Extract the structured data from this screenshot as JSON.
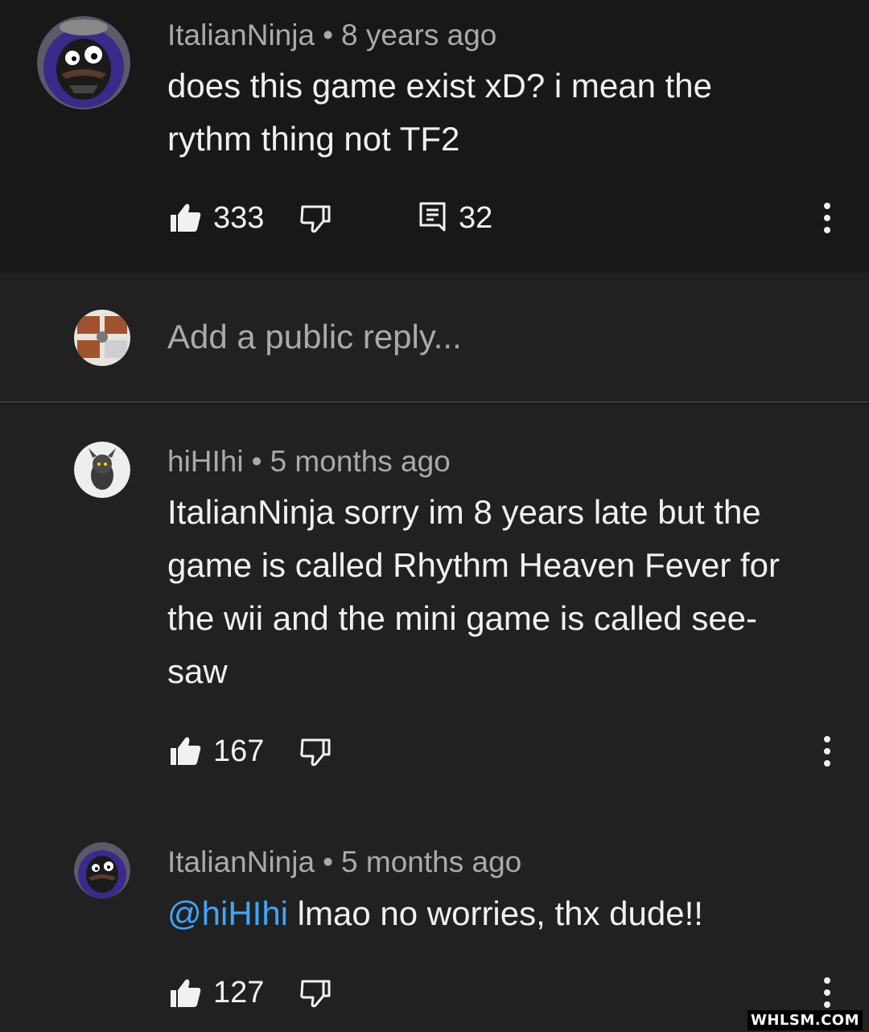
{
  "comment": {
    "author": "ItalianNinja",
    "time": "8 years ago",
    "text_line1": "does this game exist xD? i mean the",
    "text_line2": "rythm thing not TF2",
    "likes": "333",
    "reply_count": "32"
  },
  "reply_input": {
    "placeholder": "Add a public reply..."
  },
  "replies": [
    {
      "author": "hiHIhi",
      "time": "5 months ago",
      "lines": [
        "ItalianNinja sorry im 8 years late but the",
        "game is called Rhythm Heaven Fever for",
        "the wii and the mini game is called see-",
        "saw"
      ],
      "likes": "167"
    },
    {
      "author": "ItalianNinja",
      "time": "5 months ago",
      "mention": "@hiHIhi",
      "text": " lmao no worries, thx dude!!",
      "likes": "127"
    }
  ],
  "separator": "•",
  "watermark": "WHLSM.COM",
  "colors": {
    "background_top": "#181818",
    "background_replies": "#212121",
    "text_primary": "#f1f1f1",
    "text_secondary": "#aaaaaa",
    "mention": "#3ea6ff"
  },
  "icons": [
    "like-icon",
    "dislike-icon",
    "reply-icon",
    "more-options-icon"
  ]
}
